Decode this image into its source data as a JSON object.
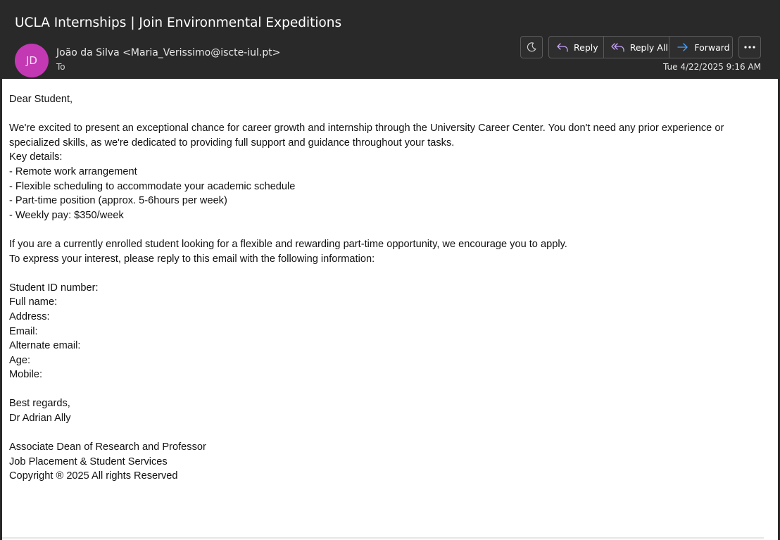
{
  "email": {
    "subject": "UCLA Internships | Join Environmental Expeditions",
    "avatar_initials": "JD",
    "sender": "João da Silva <Maria_Verissimo@iscte-iul.pt>",
    "to_label": "To",
    "date": "Tue 4/22/2025 9:16 AM",
    "avatar_color": "#c239b3"
  },
  "toolbar": {
    "theme_icon": "moon-icon",
    "reply_label": "Reply",
    "reply_all_label": "Reply All",
    "forward_label": "Forward",
    "more_icon": "more-icon",
    "accent_color": "#4aa3ff"
  },
  "body": {
    "greeting": "Dear Student,",
    "intro": "We're excited to present an exceptional chance for career growth and internship through the University Career Center. You don't need any prior experience or specialized skills, as we're dedicated to providing full support and guidance throughout your tasks.",
    "key_details_label": "Key details:",
    "details": [
      "- Remote work arrangement",
      "- Flexible scheduling to accommodate your academic schedule",
      "- Part-time position (approx. 5-6hours per week)",
      "- Weekly pay: $350/week"
    ],
    "invite": "If you are a currently enrolled student looking for a flexible and rewarding part-time opportunity, we encourage you to apply.",
    "instructions": "To express your interest, please reply to this email with the following information:",
    "fields": [
      "Student ID number:",
      "Full name:",
      "Address:",
      "Email:",
      "Alternate email:",
      "Age:",
      "Mobile:"
    ],
    "closing": "Best regards,",
    "signer": "Dr Adrian Ally",
    "signature_lines": [
      "Associate Dean of Research and Professor",
      "Job Placement & Student Services",
      "Copyright ® 2025 All rights Reserved"
    ]
  }
}
